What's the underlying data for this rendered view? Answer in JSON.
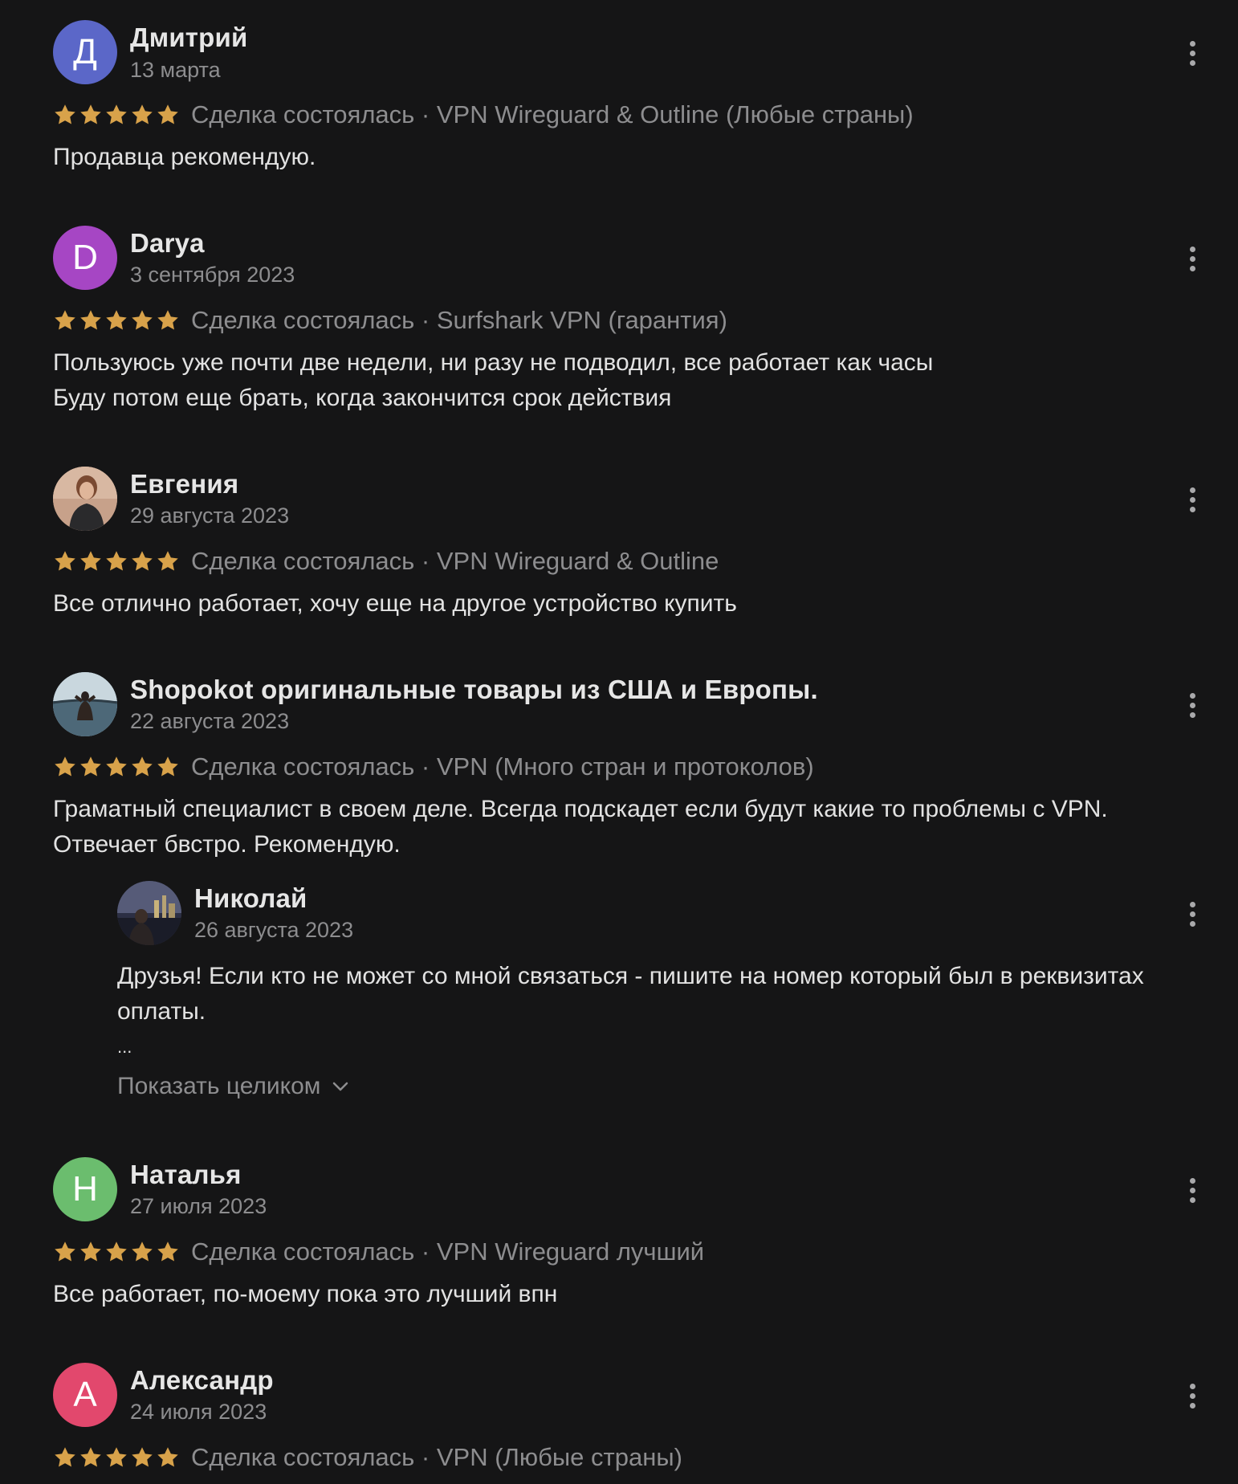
{
  "reviews": [
    {
      "name": "Дмитрий",
      "date": "13 марта",
      "avatar_letter": "Д",
      "avatar_color": "#5b67c8",
      "rating": 5,
      "deal": "Сделка состоялась · VPN Wireguard & Outline (Любые страны)",
      "text": [
        "Продавца рекомендую."
      ]
    },
    {
      "name": "Darya",
      "date": "3 сентября 2023",
      "avatar_letter": "D",
      "avatar_color": "#a646c4",
      "rating": 5,
      "deal": "Сделка состоялась · Surfshark VPN (гарантия)",
      "text": [
        "Пользуюсь уже почти две недели, ни разу не подводил, все работает как часы",
        "Буду потом еще брать, когда закончится срок действия"
      ]
    },
    {
      "name": "Евгения",
      "date": "29 августа 2023",
      "avatar_letter": "",
      "avatar_color": "#b8907a",
      "rating": 5,
      "deal": "Сделка состоялась · VPN Wireguard & Outline",
      "text": [
        "Все отлично работает, хочу еще на другое устройство купить"
      ]
    },
    {
      "name": "Shopokot оригинальные товары из США и Европы.",
      "date": "22 августа 2023",
      "avatar_letter": "",
      "avatar_color": "#6d8a9a",
      "rating": 5,
      "deal": "Сделка состоялась · VPN (Много стран и протоколов)",
      "text": [
        "Граматный специалист в своем деле. Всегда подскадет если будут какие то проблемы с VPN.",
        "Отвечает бвстро. Рекомендую."
      ]
    },
    {
      "name": "Наталья",
      "date": "27 июля 2023",
      "avatar_letter": "Н",
      "avatar_color": "#6bbd6e",
      "rating": 5,
      "deal": "Сделка состоялась · VPN Wireguard лучший",
      "text": [
        "Все работает, по-моему пока это лучший впн"
      ]
    },
    {
      "name": "Александр",
      "date": "24 июля 2023",
      "avatar_letter": "А",
      "avatar_color": "#e2486d",
      "rating": 5,
      "deal": "Сделка состоялась · VPN (Любые страны)",
      "text": []
    }
  ],
  "reply": {
    "name": "Николай",
    "date": "26 августа 2023",
    "text": [
      "Друзья! Если кто не может со мной связаться - пишите на номер который был в реквизитах",
      "оплаты.",
      "..."
    ],
    "show_more": "Показать целиком"
  },
  "colors": {
    "background": "#151516",
    "star": "#d8a24a",
    "muted": "#8d8d8f"
  }
}
